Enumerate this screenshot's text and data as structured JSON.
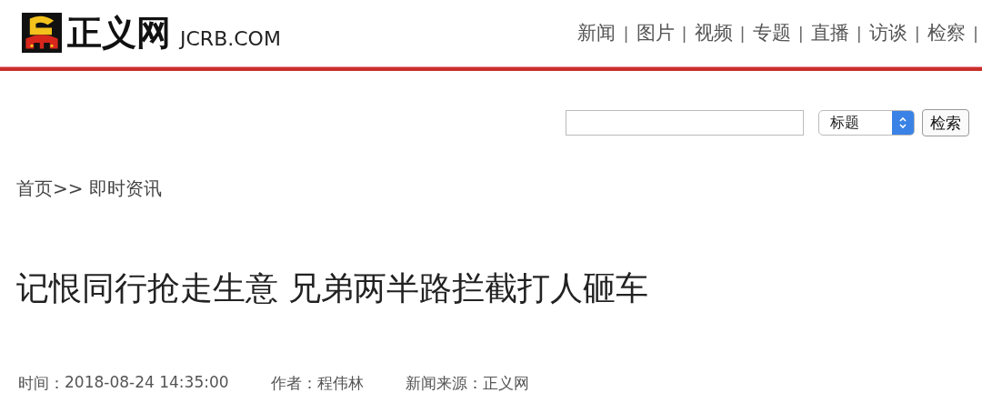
{
  "logo": {
    "name": "正义网",
    "domain": "JCRB.COM"
  },
  "nav": [
    {
      "label": "新闻"
    },
    {
      "label": "图片"
    },
    {
      "label": "视频"
    },
    {
      "label": "专题"
    },
    {
      "label": "直播"
    },
    {
      "label": "访谈"
    },
    {
      "label": "检察"
    }
  ],
  "nav_separator": "|",
  "search": {
    "select": "标题",
    "button": "检索"
  },
  "breadcrumb": {
    "items": [
      "首页",
      "即时资讯"
    ],
    "separator": ">>"
  },
  "article": {
    "title": "记恨同行抢走生意 兄弟两半路拦截打人砸车",
    "meta": [
      {
        "label": "时间：",
        "value": "2018-08-24 14:35:00"
      },
      {
        "label": "作者：",
        "value": "程伟林"
      },
      {
        "label": "新闻来源：",
        "value": "正义网"
      }
    ]
  }
}
